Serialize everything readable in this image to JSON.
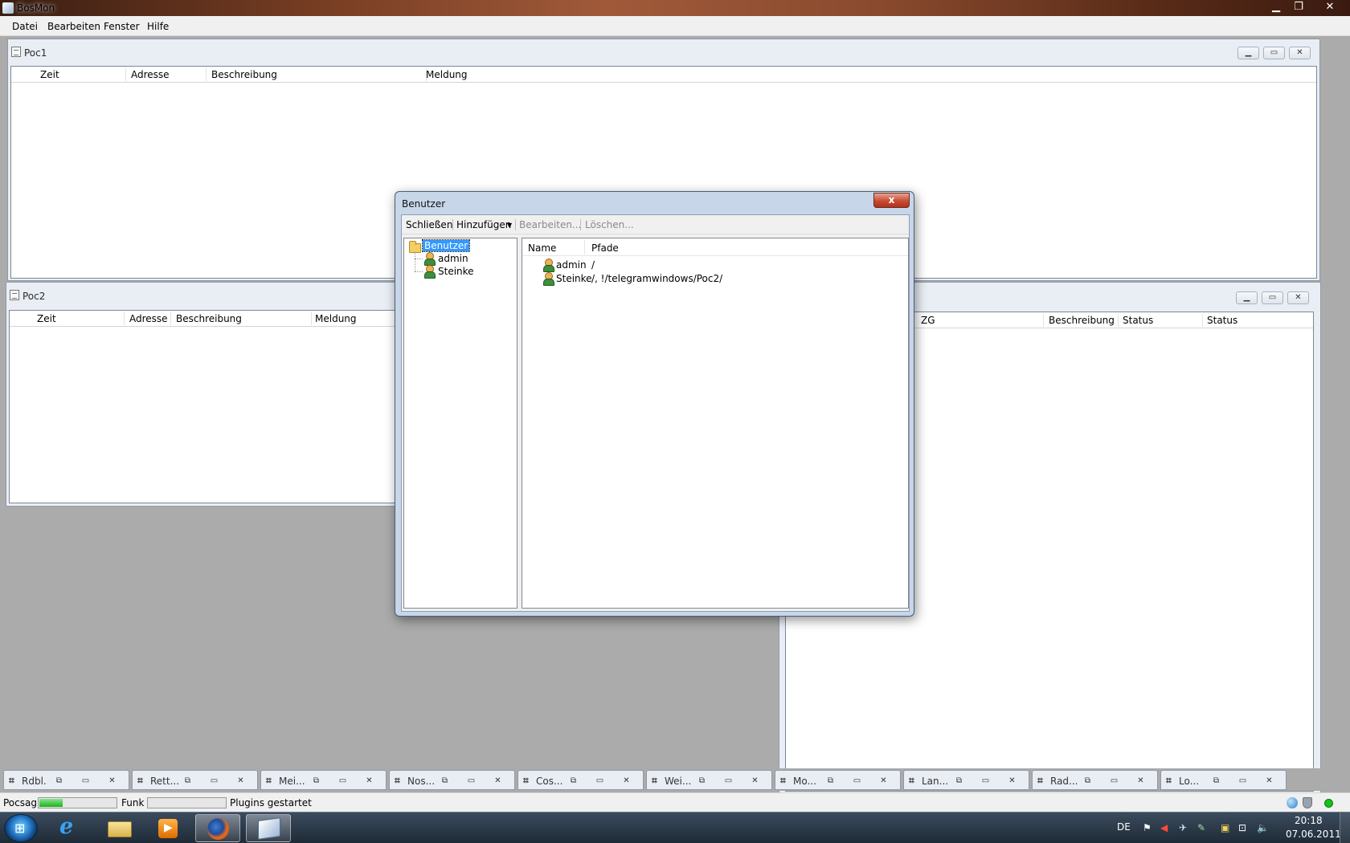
{
  "window": {
    "title": "BosMon"
  },
  "menu": [
    "Datei",
    "Bearbeiten",
    "Fenster",
    "Hilfe"
  ],
  "poc1": {
    "title": "Poc1",
    "columns": [
      "Zeit",
      "Adresse",
      "Beschreibung",
      "Meldung"
    ]
  },
  "poc2": {
    "title": "Poc2",
    "columns": [
      "Zeit",
      "Adresse",
      "Beschreibung",
      "Meldung"
    ]
  },
  "third": {
    "columns": [
      "ZG",
      "Beschreibung",
      "Status",
      "Status"
    ]
  },
  "dialog": {
    "title": "Benutzer",
    "close_glyph": "x",
    "toolbar": {
      "close": "Schließen",
      "add": "Hinzufügen",
      "edit": "Bearbeiten...",
      "delete": "Löschen..."
    },
    "tree": {
      "root": "Benutzer",
      "children": [
        "admin",
        "Steinke"
      ]
    },
    "list": {
      "columns": [
        "Name",
        "Pfade"
      ],
      "rows": [
        {
          "name": "admin",
          "paths": "/"
        },
        {
          "name": "Steinke",
          "paths": "/, !/telegramwindows/Poc2/"
        }
      ]
    }
  },
  "minimized_windows": [
    "Rdbl.",
    "Rett...",
    "Mei...",
    "Nos...",
    "Cos...",
    "Wei...",
    "Mo...",
    "Lan...",
    "Rad...",
    "Lo..."
  ],
  "status": {
    "pocsag_label": "Pocsag",
    "pocsag_progress": 0.3,
    "funk_label": "Funk",
    "funk_progress": 0,
    "message": "Plugins gestartet"
  },
  "tray": {
    "language": "DE",
    "time": "20:18",
    "date": "07.06.2011"
  },
  "colors": {
    "selection": "#3399ff",
    "progress_green": "#17b31b",
    "dialog_close": "#c94b32"
  }
}
